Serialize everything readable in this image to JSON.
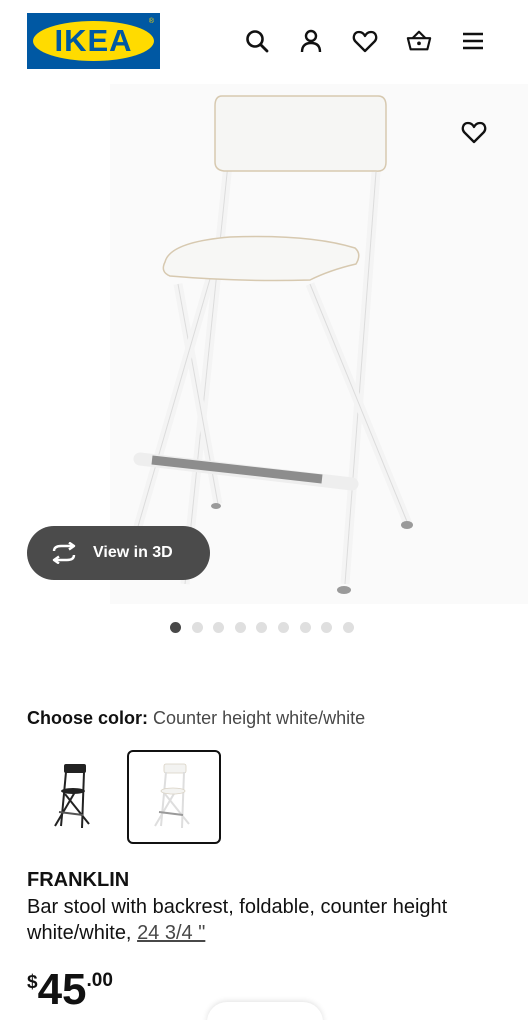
{
  "header": {
    "logo_text": "IKEA",
    "logo_colors": {
      "blue": "#0058a3",
      "yellow": "#ffdb00"
    },
    "icons": [
      "search-icon",
      "account-icon",
      "heart-icon",
      "basket-icon",
      "menu-icon"
    ]
  },
  "gallery": {
    "view_3d_label": "View in 3D",
    "image_count": 9,
    "active_index": 0
  },
  "color_picker": {
    "label": "Choose color:",
    "selected_value": "Counter height white/white",
    "options": [
      "black",
      "white"
    ],
    "selected_option": "white"
  },
  "product": {
    "name": "FRANKLIN",
    "description": "Bar stool with backrest, foldable, counter height white/white, ",
    "size_link": "24 3/4 \"",
    "price": {
      "currency": "$",
      "integer": "45",
      "decimal": ".00"
    }
  }
}
